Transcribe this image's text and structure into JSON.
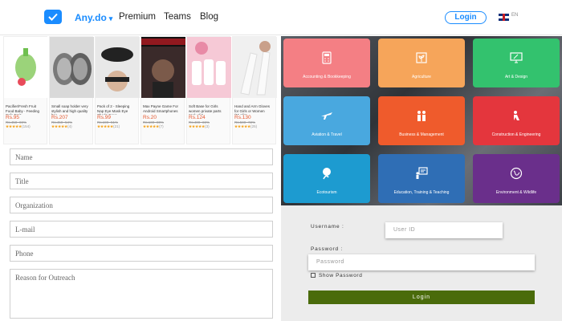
{
  "nav": {
    "brand": "Any.do",
    "links": [
      "Premium",
      "Teams",
      "Blog"
    ],
    "login": "Login",
    "lang": "EN"
  },
  "products": [
    {
      "title": "Pacifier/Fresh Fruit Food Baby - Feeding Safe Fruit...",
      "price": "Rs.95",
      "old": "Rs.450 -69%",
      "stars": "★★★★★",
      "count": "(154)"
    },
    {
      "title": "Small soap holder very stylish and high quality bea...",
      "price": "Rs.207",
      "old": "Rs.450 -54%",
      "stars": "★★★★★",
      "count": "(4)"
    },
    {
      "title": "Pack of 2 - Sleeping Nap Eye Mask Eye Shade Cove...",
      "price": "Rs.99",
      "old": "Rs.199 -51%",
      "stars": "★★★★★",
      "count": "(21)"
    },
    {
      "title": "Max Payne Game For Android Smartphones -...",
      "price": "Rs.20",
      "old": "Rs.100 -80%",
      "stars": "★★★★★",
      "count": "(7)"
    },
    {
      "title": "Soft Base for Girls women private parts pack of 6",
      "price": "Rs.124",
      "old": "Rs.400 -69%",
      "stars": "★★★★★",
      "count": "(3)"
    },
    {
      "title": "Hand and Arm Gloves for Girls or Women (Muslim...",
      "price": "Rs.130",
      "old": "Rs.500 -72%",
      "stars": "★★★★★",
      "count": "(25)"
    }
  ],
  "form": {
    "name": "Name",
    "title": "Title",
    "organization": "Organization",
    "email": "L-mail",
    "phone": "Phone",
    "reason": "Reason for Outreach"
  },
  "categories": [
    "Accounting & Bookkeeping",
    "Agriculture",
    "Art & Design",
    "Aviation & Travel",
    "Business & Management",
    "Construction & Engineering",
    "Ecotourism",
    "Education, Training & Teaching",
    "Environment & Wildlife"
  ],
  "login": {
    "username_label": "Username :",
    "userid_placeholder": "User ID",
    "password_label": "Password :",
    "password_placeholder": "Password",
    "show_password": "Show Password",
    "button": "Login"
  }
}
